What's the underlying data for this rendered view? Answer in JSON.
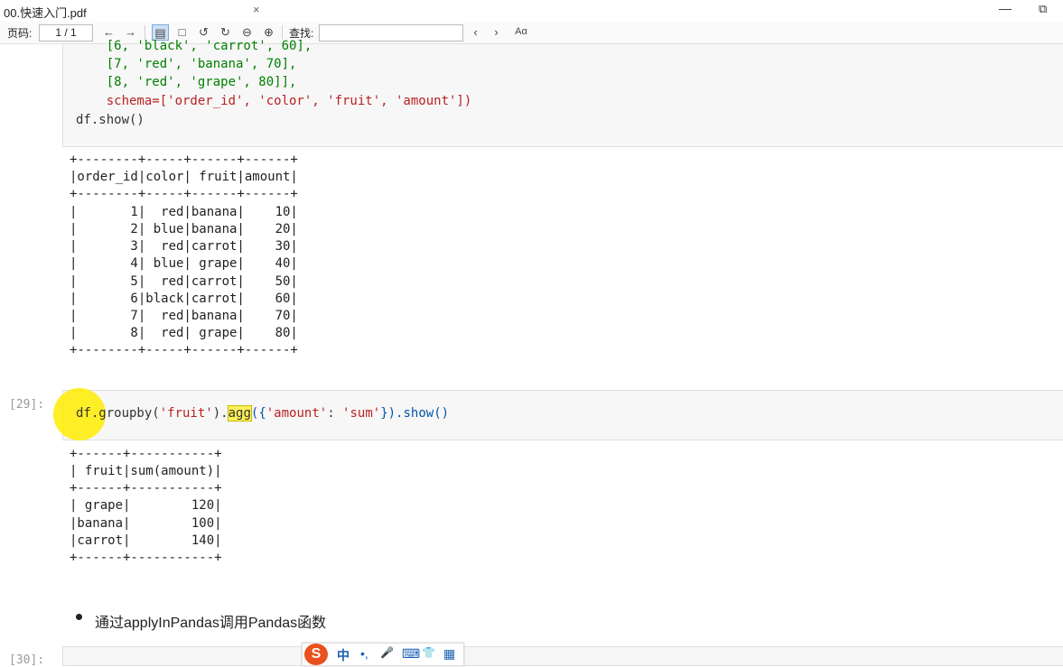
{
  "window": {
    "tab_title": "00.快速入门.pdf",
    "close_glyph": "×",
    "min_glyph": "—",
    "max_glyph": "⧉"
  },
  "toolbar": {
    "page_label": "页码:",
    "page_value": "1 / 1",
    "find_label": "查找:",
    "find_value": "",
    "font_label": "Aα"
  },
  "cell1": {
    "lines": [
      "    [6, 'black', 'carrot', 60],",
      "    [7, 'red', 'banana', 70],",
      "    [8, 'red', 'grape', 80]],",
      "    schema=['order_id', 'color', 'fruit', 'amount'])",
      "df.show()"
    ]
  },
  "output1": {
    "lines": [
      "+--------+-----+------+------+",
      "|order_id|color| fruit|amount|",
      "+--------+-----+------+------+",
      "|       1|  red|banana|    10|",
      "|       2| blue|banana|    20|",
      "|       3|  red|carrot|    30|",
      "|       4| blue| grape|    40|",
      "|       5|  red|carrot|    50|",
      "|       6|black|carrot|    60|",
      "|       7|  red|banana|    70|",
      "|       8|  red| grape|    80|",
      "+--------+-----+------+------+"
    ]
  },
  "cell2": {
    "prompt": "[29]:",
    "code_pre": "df.groupby(",
    "code_str1": "'fruit'",
    "code_mid": ").",
    "code_hl": "agg",
    "code_open": "({",
    "code_str2": "'amount'",
    "code_colon": ": ",
    "code_str3": "'sum'",
    "code_close": "}).show()"
  },
  "output2": {
    "lines": [
      "+------+-----------+",
      "| fruit|sum(amount)|",
      "+------+-----------+",
      "| grape|        120|",
      "|banana|        100|",
      "|carrot|        140|",
      "+------+-----------+"
    ]
  },
  "markdown": {
    "bullet_text": "通过applyInPandas调用Pandas函数"
  },
  "cell3": {
    "prompt": "[30]:"
  },
  "ime": {
    "logo": "S",
    "lang": "中",
    "punct": "•,",
    "mic": "🎤",
    "kbd": "⌨",
    "skin": "👕",
    "grid": "▦"
  }
}
